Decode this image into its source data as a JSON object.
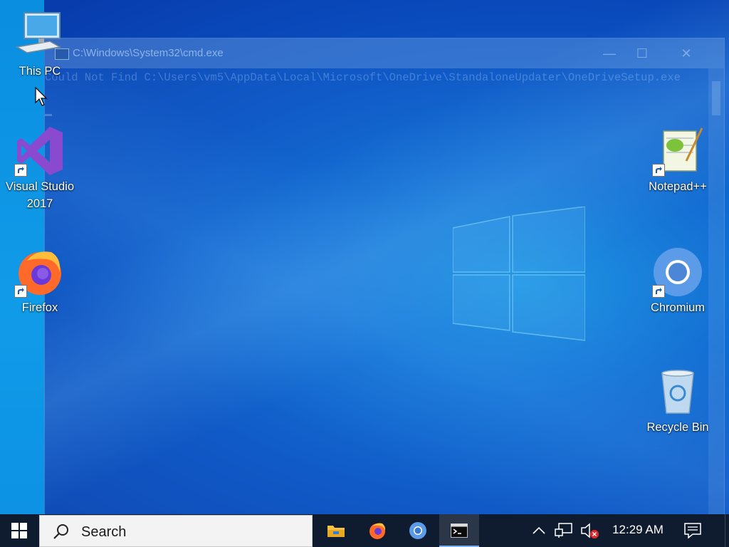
{
  "cmd": {
    "title": "C:\\Windows\\System32\\cmd.exe",
    "output": "Could Not Find C:\\Users\\vm5\\AppData\\Local\\Microsoft\\OneDrive\\StandaloneUpdater\\OneDriveSetup.exe",
    "minimize": "—",
    "maximize": "☐",
    "close": "✕"
  },
  "desktop_icons": {
    "this_pc": "This PC",
    "visual_studio_line1": "Visual Studio",
    "visual_studio_line2": "2017",
    "firefox": "Firefox",
    "notepadpp": "Notepad++",
    "chromium": "Chromium",
    "recycle_bin": "Recycle Bin"
  },
  "taskbar": {
    "search_text": "Search",
    "clock": "12:29 AM"
  },
  "icons": {
    "start": "windows-logo-icon",
    "search": "magnifier-icon",
    "file_explorer": "folder-icon",
    "firefox": "firefox-icon",
    "chromium": "chromium-icon",
    "terminal": "terminal-icon",
    "tray_chevron": "chevron-up-icon",
    "network": "network-icon",
    "volume": "volume-muted-icon",
    "notifications": "action-center-icon"
  },
  "colors": {
    "taskbar_bg": "#0f1b2e",
    "desktop_bg": "#0a52c4",
    "accent": "#7ab4f0"
  }
}
